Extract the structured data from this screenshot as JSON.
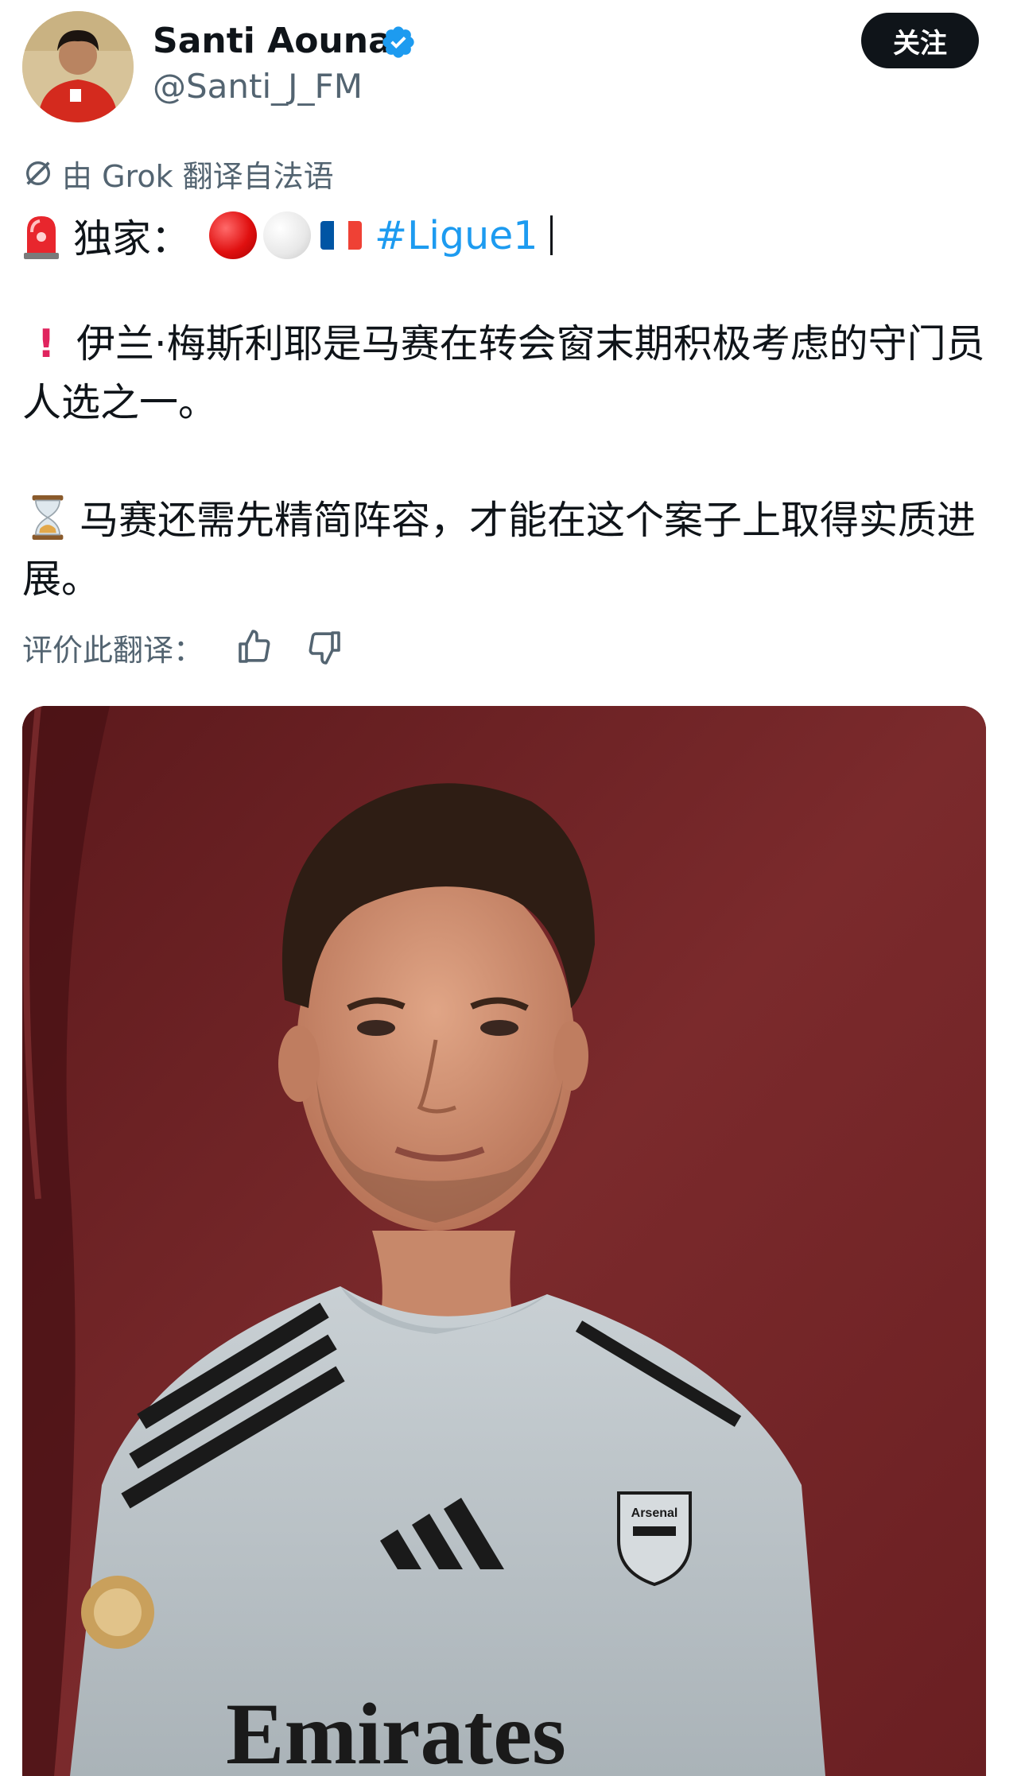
{
  "author": {
    "name": "Santi Aouna",
    "handle": "@Santi_J_FM",
    "verified_icon": "verified-badge-icon",
    "avatar_icon": "avatar-photo"
  },
  "follow_button": {
    "label": "关注"
  },
  "translation": {
    "label": "由 Grok 翻译自法语",
    "icon": "grok-icon"
  },
  "tweet": {
    "exclusive_label": "独家：",
    "hashtag": "#Ligue1",
    "line2": "伊兰·梅斯利耶是马赛在转会窗末期积极考虑的守门员人选之一。",
    "line3": "马赛还需先精简阵容，才能在这个案子上取得实质进展。",
    "flag_colors": [
      "#0055a4",
      "#ffffff",
      "#ef4135"
    ]
  },
  "rating": {
    "label": "评价此翻译：",
    "up_icon": "thumbs-up-icon",
    "down_icon": "thumbs-down-icon"
  },
  "media": {
    "description_icon": "player-photo",
    "shirt_text": "Emirates",
    "crest_text": "Arsenal"
  },
  "colors": {
    "text": "#0f1419",
    "secondary": "#536471",
    "link": "#1d9bf0",
    "background": "#ffffff",
    "media_bg": "#6d2023"
  }
}
